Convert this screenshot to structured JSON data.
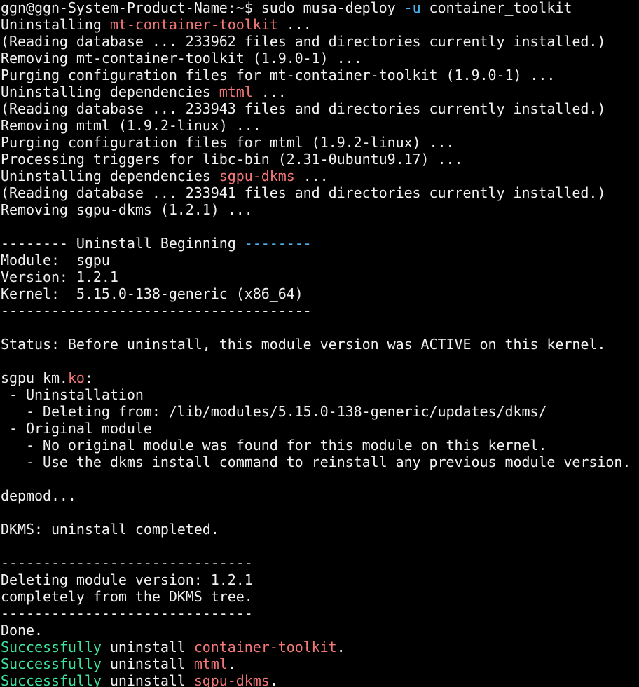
{
  "colors": {
    "background": "#000000",
    "default": "#f2f2f2",
    "red": "#f47878",
    "blue": "#4fb4f0",
    "green": "#3ee39a"
  },
  "terminal": {
    "lines": [
      [
        {
          "t": "ggn@ggn-System-Product-Name:~$ sudo musa-deploy ",
          "c": "default"
        },
        {
          "t": "-u",
          "c": "blue"
        },
        {
          "t": " container_toolkit",
          "c": "default"
        }
      ],
      [
        {
          "t": "Uninstalling ",
          "c": "default"
        },
        {
          "t": "mt-container-toolkit",
          "c": "red"
        },
        {
          "t": " ...",
          "c": "default"
        }
      ],
      [
        {
          "t": "(Reading database ... 233962 files and directories currently installed.)",
          "c": "default"
        }
      ],
      [
        {
          "t": "Removing mt-container-toolkit (1.9.0-1) ...",
          "c": "default"
        }
      ],
      [
        {
          "t": "Purging configuration files for mt-container-toolkit (1.9.0-1) ...",
          "c": "default"
        }
      ],
      [
        {
          "t": "Uninstalling dependencies ",
          "c": "default"
        },
        {
          "t": "mtml",
          "c": "red"
        },
        {
          "t": " ...",
          "c": "default"
        }
      ],
      [
        {
          "t": "(Reading database ... 233943 files and directories currently installed.)",
          "c": "default"
        }
      ],
      [
        {
          "t": "Removing mtml (1.9.2-linux) ...",
          "c": "default"
        }
      ],
      [
        {
          "t": "Purging configuration files for mtml (1.9.2-linux) ...",
          "c": "default"
        }
      ],
      [
        {
          "t": "Processing triggers for libc-bin (2.31-0ubuntu9.17) ...",
          "c": "default"
        }
      ],
      [
        {
          "t": "Uninstalling dependencies ",
          "c": "default"
        },
        {
          "t": "sgpu-dkms",
          "c": "red"
        },
        {
          "t": " ...",
          "c": "default"
        }
      ],
      [
        {
          "t": "(Reading database ... 233941 files and directories currently installed.)",
          "c": "default"
        }
      ],
      [
        {
          "t": "Removing sgpu-dkms (1.2.1) ...",
          "c": "default"
        }
      ],
      [],
      [
        {
          "t": "-------- Uninstall Beginning ",
          "c": "default"
        },
        {
          "t": "--------",
          "c": "blue"
        }
      ],
      [
        {
          "t": "Module:  sgpu",
          "c": "default"
        }
      ],
      [
        {
          "t": "Version: 1.2.1",
          "c": "default"
        }
      ],
      [
        {
          "t": "Kernel:  5.15.0-138-generic (x86_64)",
          "c": "default"
        }
      ],
      [
        {
          "t": "-------------------------------------",
          "c": "default"
        }
      ],
      [],
      [
        {
          "t": "Status: Before uninstall, this module version was ACTIVE on this kernel.",
          "c": "default"
        }
      ],
      [],
      [
        {
          "t": "sgpu_km.",
          "c": "default"
        },
        {
          "t": "ko",
          "c": "red"
        },
        {
          "t": ":",
          "c": "default"
        }
      ],
      [
        {
          "t": " - Uninstallation",
          "c": "default"
        }
      ],
      [
        {
          "t": "   - Deleting from: /lib/modules/5.15.0-138-generic/updates/dkms/",
          "c": "default"
        }
      ],
      [
        {
          "t": " - Original module",
          "c": "default"
        }
      ],
      [
        {
          "t": "   - No original module was found for this module on this kernel.",
          "c": "default"
        }
      ],
      [
        {
          "t": "   - Use the dkms install command to reinstall any previous module version.",
          "c": "default"
        }
      ],
      [],
      [
        {
          "t": "depmod...",
          "c": "default"
        }
      ],
      [],
      [
        {
          "t": "DKMS: uninstall completed.",
          "c": "default"
        }
      ],
      [],
      [
        {
          "t": "------------------------------",
          "c": "default"
        }
      ],
      [
        {
          "t": "Deleting module version: 1.2.1",
          "c": "default"
        }
      ],
      [
        {
          "t": "completely from the DKMS tree.",
          "c": "default"
        }
      ],
      [
        {
          "t": "------------------------------",
          "c": "default"
        }
      ],
      [
        {
          "t": "Done.",
          "c": "default"
        }
      ],
      [
        {
          "t": "Successfully",
          "c": "green"
        },
        {
          "t": " uninstall ",
          "c": "default"
        },
        {
          "t": "container-toolkit",
          "c": "red"
        },
        {
          "t": ".",
          "c": "default"
        }
      ],
      [
        {
          "t": "Successfully",
          "c": "green"
        },
        {
          "t": " uninstall ",
          "c": "default"
        },
        {
          "t": "mtml",
          "c": "red"
        },
        {
          "t": ".",
          "c": "default"
        }
      ],
      [
        {
          "t": "Successfully",
          "c": "green"
        },
        {
          "t": " uninstall ",
          "c": "default"
        },
        {
          "t": "sgpu-dkms",
          "c": "red"
        },
        {
          "t": ".",
          "c": "default"
        }
      ]
    ]
  }
}
